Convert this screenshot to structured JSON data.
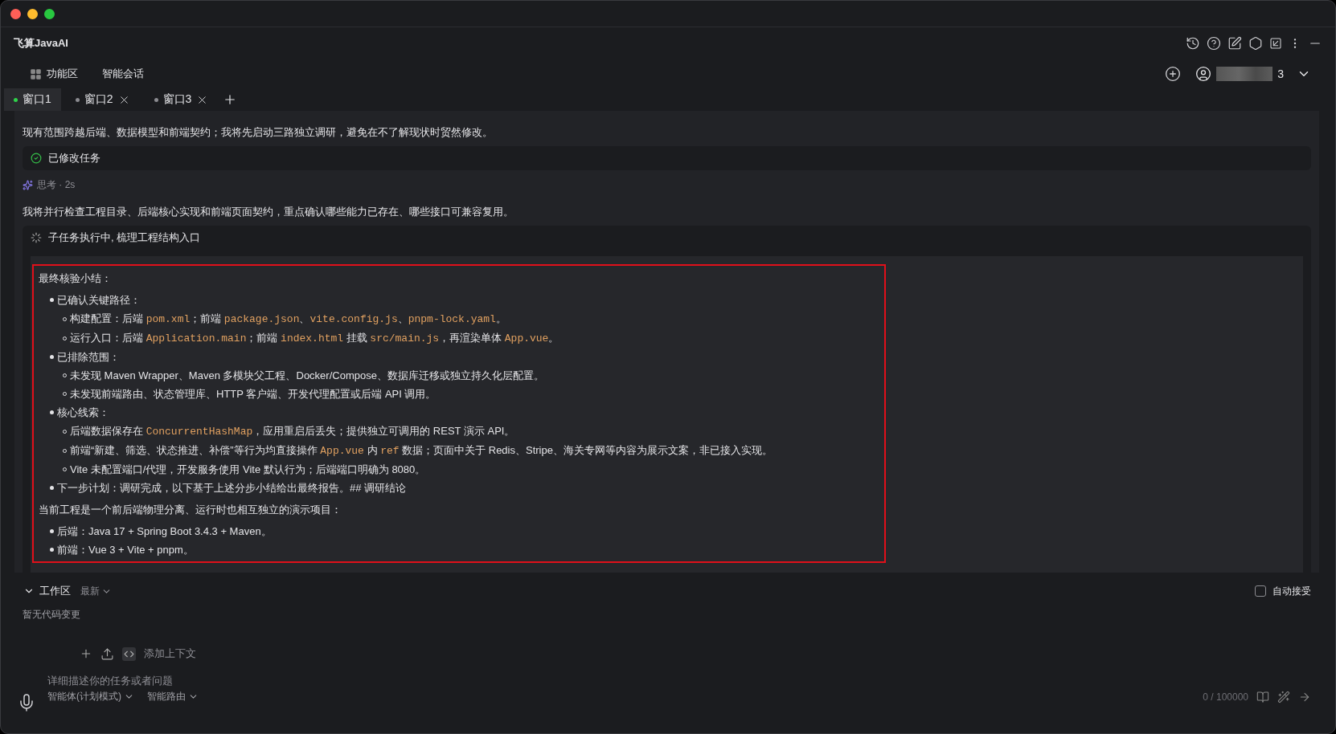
{
  "app_title": "飞算JavaAI",
  "nav": [
    {
      "label": "功能区"
    },
    {
      "label": "智能会话"
    }
  ],
  "user": {
    "name": "3"
  },
  "tabs": [
    {
      "label": "窗口1",
      "selected": true,
      "closable": false
    },
    {
      "label": "窗口2",
      "selected": false,
      "closable": true
    },
    {
      "label": "窗口3",
      "selected": false,
      "closable": true
    }
  ],
  "messages": [
    {
      "kind": "text",
      "text": "现有范围跨越后端、数据模型和前端契约；我将先启动三路独立调研，避免在不了解现状时贸然修改。"
    },
    {
      "kind": "status",
      "text": "已修改任务",
      "done": true
    },
    {
      "kind": "thinking",
      "text": "思考 · 2s"
    },
    {
      "kind": "text",
      "text": "我将并行检查工程目录、后端核心实现和前端页面契约，重点确认哪些能力已存在、哪些接口可兼容复用。"
    }
  ],
  "subtask": {
    "title": "子任务执行中, 梳理工程结构入口",
    "running": true
  },
  "report": {
    "heading": "最终核验小结：",
    "items": [
      {
        "text": "已确认关键路径：",
        "children": [
          {
            "parts": [
              {
                "kind": "text",
                "text": "构建配置：后端 "
              },
              {
                "kind": "code",
                "text": "pom.xml"
              },
              {
                "kind": "text",
                "text": "；前端 "
              },
              {
                "kind": "code",
                "text": "package.json"
              },
              {
                "kind": "text",
                "text": "、"
              },
              {
                "kind": "code",
                "text": "vite.config.js"
              },
              {
                "kind": "text",
                "text": "、"
              },
              {
                "kind": "code",
                "text": "pnpm-lock.yaml"
              },
              {
                "kind": "text",
                "text": "。"
              }
            ]
          },
          {
            "parts": [
              {
                "kind": "text",
                "text": "运行入口：后端 "
              },
              {
                "kind": "code",
                "text": "Application.main"
              },
              {
                "kind": "text",
                "text": "；前端 "
              },
              {
                "kind": "code",
                "text": "index.html"
              },
              {
                "kind": "text",
                "text": " 挂载 "
              },
              {
                "kind": "code",
                "text": "src/main.js"
              },
              {
                "kind": "text",
                "text": "，再渲染单体 "
              },
              {
                "kind": "code",
                "text": "App.vue"
              },
              {
                "kind": "text",
                "text": "。"
              }
            ]
          }
        ]
      },
      {
        "text": "已排除范围：",
        "children": [
          {
            "parts": [
              {
                "kind": "text",
                "text": "未发现 Maven Wrapper、Maven 多模块父工程、Docker/Compose、数据库迁移或独立持久化层配置。"
              }
            ]
          },
          {
            "parts": [
              {
                "kind": "text",
                "text": "未发现前端路由、状态管理库、HTTP 客户端、开发代理配置或后端 API 调用。"
              }
            ]
          }
        ]
      },
      {
        "text": "核心线索：",
        "children": [
          {
            "parts": [
              {
                "kind": "text",
                "text": "后端数据保存在 "
              },
              {
                "kind": "code",
                "text": "ConcurrentHashMap"
              },
              {
                "kind": "text",
                "text": "，应用重启后丢失；提供独立可调用的 REST 演示 API。"
              }
            ]
          },
          {
            "parts": [
              {
                "kind": "text",
                "text": "前端“新建、筛选、状态推进、补偿”等行为均直接操作 "
              },
              {
                "kind": "code",
                "text": "App.vue"
              },
              {
                "kind": "text",
                "text": " 内 "
              },
              {
                "kind": "code",
                "text": "ref"
              },
              {
                "kind": "text",
                "text": " 数据；页面中关于 Redis、Stripe、海关专网等内容为展示文案，非已接入实现。"
              }
            ]
          },
          {
            "parts": [
              {
                "kind": "text",
                "text": "Vite 未配置端口/代理，开发服务使用 Vite 默认行为；后端端口明确为 8080。"
              }
            ]
          }
        ]
      },
      {
        "text": "下一步计划：调研完成，以下基于上述分步小结给出最终报告。## 调研结论"
      }
    ],
    "paragraph": "当前工程是一个前后端物理分离、运行时也相互独立的演示项目：",
    "items2": [
      {
        "text": "后端：Java 17 + Spring Boot 3.4.3 + Maven。"
      },
      {
        "text": "前端：Vue 3 + Vite + pnpm。"
      }
    ]
  },
  "workspace": {
    "title": "工作区",
    "sort": "最新",
    "expanded": true,
    "auto_accept": {
      "label": "自动接受",
      "checked": false
    },
    "empty": "暂无代码变更"
  },
  "composer": {
    "context_label": "添加上下文",
    "placeholder": "详细描述你的任务或者问题",
    "mode": "智能体(计划模式)",
    "route": "智能路由",
    "counter": "0 / 100000"
  }
}
